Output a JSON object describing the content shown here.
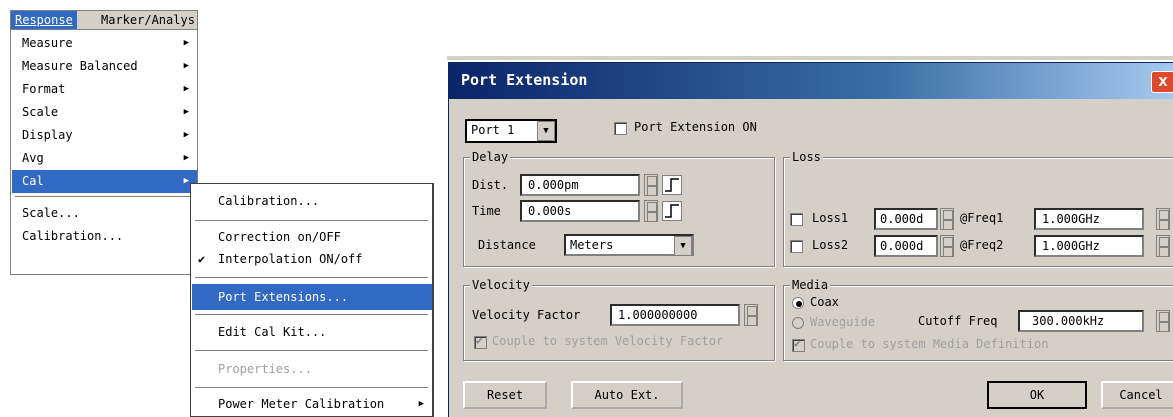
{
  "menubar": {
    "items": [
      {
        "label": "Response",
        "ul": "R"
      },
      {
        "label": "Marker/Analys"
      }
    ]
  },
  "response_menu": {
    "items": [
      "Measure",
      "Measure Balanced",
      "Format",
      "Scale",
      "Display",
      "Avg",
      "Cal",
      "Scale...",
      "Calibration..."
    ]
  },
  "cal_menu": {
    "items": [
      "Calibration...",
      "Correction on/OFF",
      "Interpolation ON/off",
      "Port Extensions...",
      "Edit Cal Kit...",
      "Properties...",
      "Power Meter Calibration"
    ],
    "check": "✔"
  },
  "dialog": {
    "title": "Port Extension",
    "close": "X",
    "port_select": "Port 1",
    "port_ext_on_label": "Port Extension ON",
    "delay": {
      "label": "Delay",
      "dist_label": "Dist.",
      "dist_value": "0.000pm",
      "time_label": "Time",
      "time_value": "0.000s",
      "distance_label": "Distance",
      "distance_unit": "Meters"
    },
    "loss": {
      "label": "Loss",
      "loss1_label": "Loss1",
      "loss1_value": "0.000d",
      "freq1_label": "@Freq1",
      "freq1_value": "1.000GHz",
      "loss2_label": "Loss2",
      "loss2_value": "0.000d",
      "freq2_label": "@Freq2",
      "freq2_value": "1.000GHz"
    },
    "velocity": {
      "label": "Velocity",
      "factor_label": "Velocity Factor",
      "factor_value": "1.000000000",
      "couple_label": "Couple to system Velocity Factor"
    },
    "media": {
      "label": "Media",
      "coax_label": "Coax",
      "waveguide_label": "Waveguide",
      "cutoff_label": "Cutoff Freq",
      "cutoff_value": "300.000kHz",
      "couple_label": "Couple to system Media Definition"
    },
    "buttons": {
      "reset": "Reset",
      "auto_ext": "Auto Ext.",
      "ok": "OK",
      "cancel": "Cancel"
    }
  },
  "colors": {
    "highlight": "#316ac5",
    "title_bar": "#0a246a",
    "dialog_bg": "#d4d0c8"
  }
}
